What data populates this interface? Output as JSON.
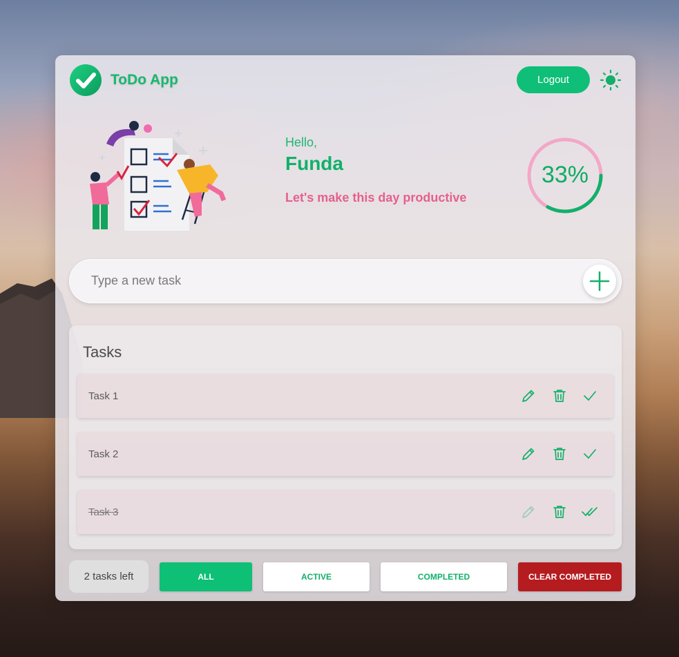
{
  "header": {
    "logo_icon": "check-circle-icon",
    "title": "ToDo App",
    "logout_label": "Logout",
    "theme_icon": "sun-icon"
  },
  "hero": {
    "illustration": "checklist-people-illustration",
    "greeting": "Hello,",
    "user_name": "Funda",
    "motto": "Let's make this day productive",
    "progress_percent": 33,
    "progress_label": "33%"
  },
  "new_task": {
    "placeholder": "Type a new task",
    "add_icon": "plus-icon"
  },
  "tasks_panel": {
    "title": "Tasks",
    "items": [
      {
        "label": "Task 1",
        "completed": false
      },
      {
        "label": "Task 2",
        "completed": false
      },
      {
        "label": "Task 3",
        "completed": true
      }
    ],
    "action_icons": [
      "pencil-icon",
      "trash-icon",
      "check-icon",
      "double-check-icon"
    ]
  },
  "footer": {
    "tasks_left": "2 tasks left",
    "filter_all": "ALL",
    "filter_active": "ACTIVE",
    "filter_completed": "COMPLETED",
    "clear_completed": "CLEAR COMPLETED"
  },
  "colors": {
    "accent": "#0fbf77",
    "pink": "#e5608c",
    "danger": "#b51c1f",
    "ring_track": "#f3a7c7"
  }
}
